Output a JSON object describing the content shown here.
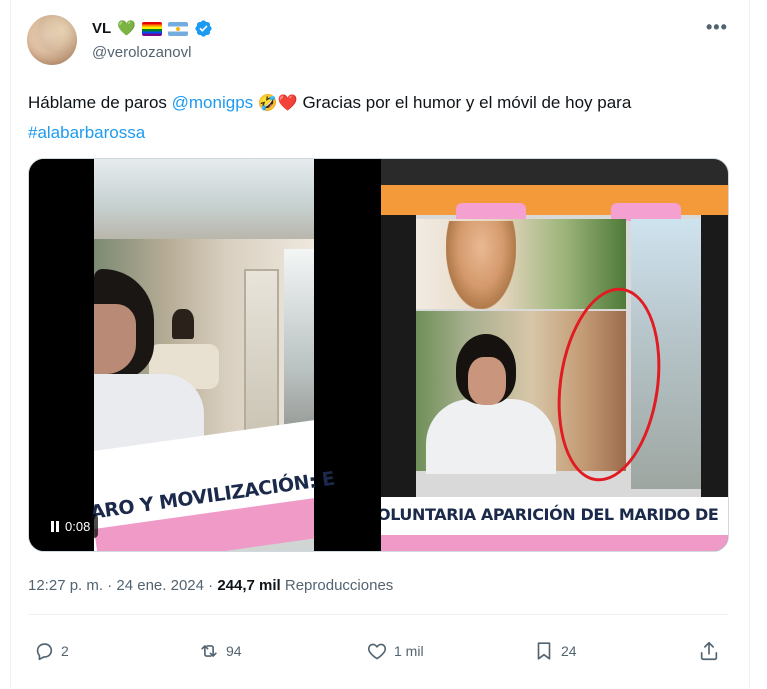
{
  "author": {
    "display_name": "VL",
    "handle": "@verolozanovl",
    "name_emojis": [
      "💚",
      "🏳️‍🌈",
      "🇦🇷"
    ],
    "verified_icon": "verified-badge-icon",
    "verified_color": "#1d9bf0"
  },
  "tweet": {
    "text_part1": "Háblame de paros ",
    "mention": "@monigps",
    "emoji1": "🤣",
    "emoji2": "❤️",
    "text_part2": " Gracias por el humor y el móvil de hoy para ",
    "hashtag": "#alabarbarossa",
    "link_color": "#1d9bf0"
  },
  "media": {
    "left_video_banner": "ARO Y MOVILIZACIÓN: E",
    "video_time": "0:08",
    "right_image_banner": "OLUNTARIA APARICIÓN DEL MARIDO DE"
  },
  "meta": {
    "time": "12:27 p. m.",
    "separator": " · ",
    "date": "24 ene. 2024",
    "views_count": "244,7 mil",
    "views_label": " Reproducciones"
  },
  "actions": {
    "replies": "2",
    "retweets": "94",
    "likes": "1 mil",
    "bookmarks": "24"
  },
  "icons": {
    "more": "more-options-icon",
    "reply": "reply-icon",
    "retweet": "retweet-icon",
    "like": "heart-icon",
    "bookmark": "bookmark-icon",
    "share": "share-icon",
    "pause": "pause-icon"
  },
  "colors": {
    "text_primary": "#0f1419",
    "text_secondary": "#536471",
    "accent": "#1d9bf0"
  }
}
